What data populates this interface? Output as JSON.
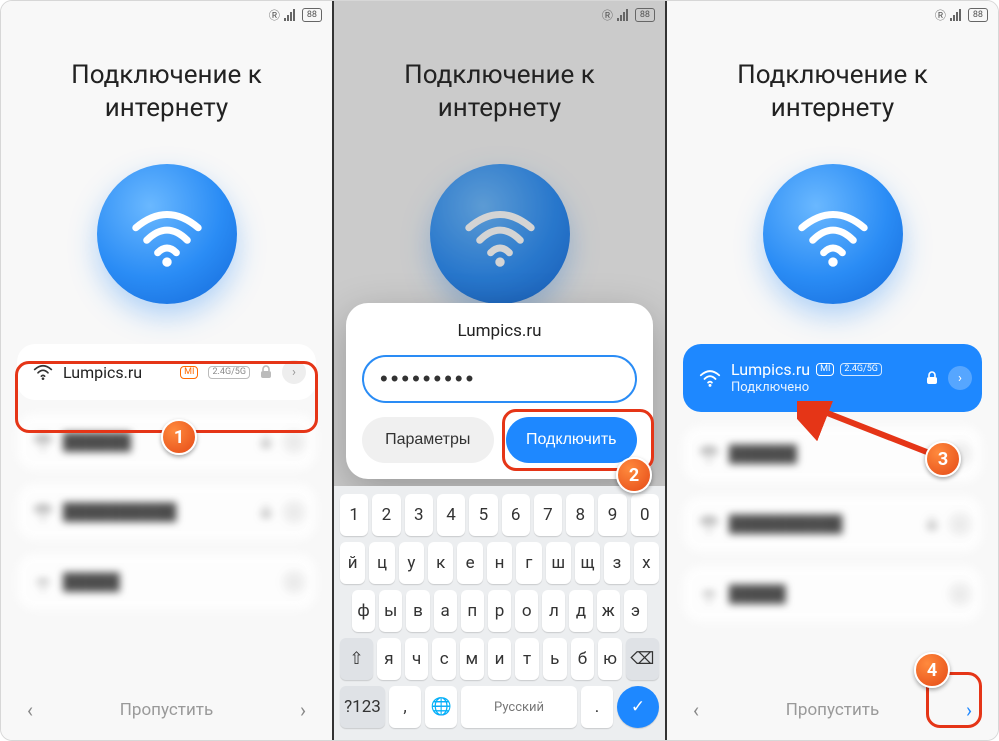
{
  "status": {
    "battery": "88"
  },
  "title": "Подключение к интернету",
  "networks": {
    "main": {
      "ssid": "Lumpics.ru",
      "band": "2.4G/5G",
      "mi": "MI",
      "connected_status": "Подключено"
    }
  },
  "nav": {
    "skip": "Пропустить",
    "prev": "‹",
    "next": "›"
  },
  "dialog": {
    "title": "Lumpics.ru",
    "password_mask": "•••••••••",
    "params": "Параметры",
    "connect": "Подключить"
  },
  "keyboard": {
    "row1": [
      "1",
      "2",
      "3",
      "4",
      "5",
      "6",
      "7",
      "8",
      "9",
      "0"
    ],
    "row2": [
      "й",
      "ц",
      "у",
      "к",
      "е",
      "н",
      "г",
      "ш",
      "щ",
      "з",
      "х"
    ],
    "row3": [
      "ф",
      "ы",
      "в",
      "а",
      "п",
      "р",
      "о",
      "л",
      "д",
      "ж",
      "э"
    ],
    "row4_shift": "⇧",
    "row4": [
      "я",
      "ч",
      "с",
      "м",
      "и",
      "т",
      "ь",
      "б",
      "ю"
    ],
    "row4_bksp": "⌫",
    "sym": "?123",
    "comma": ",",
    "globe": "🌐",
    "space": "Русский",
    "period": ".",
    "go": "✓"
  },
  "badges": {
    "b1": "1",
    "b2": "2",
    "b3": "3",
    "b4": "4"
  }
}
